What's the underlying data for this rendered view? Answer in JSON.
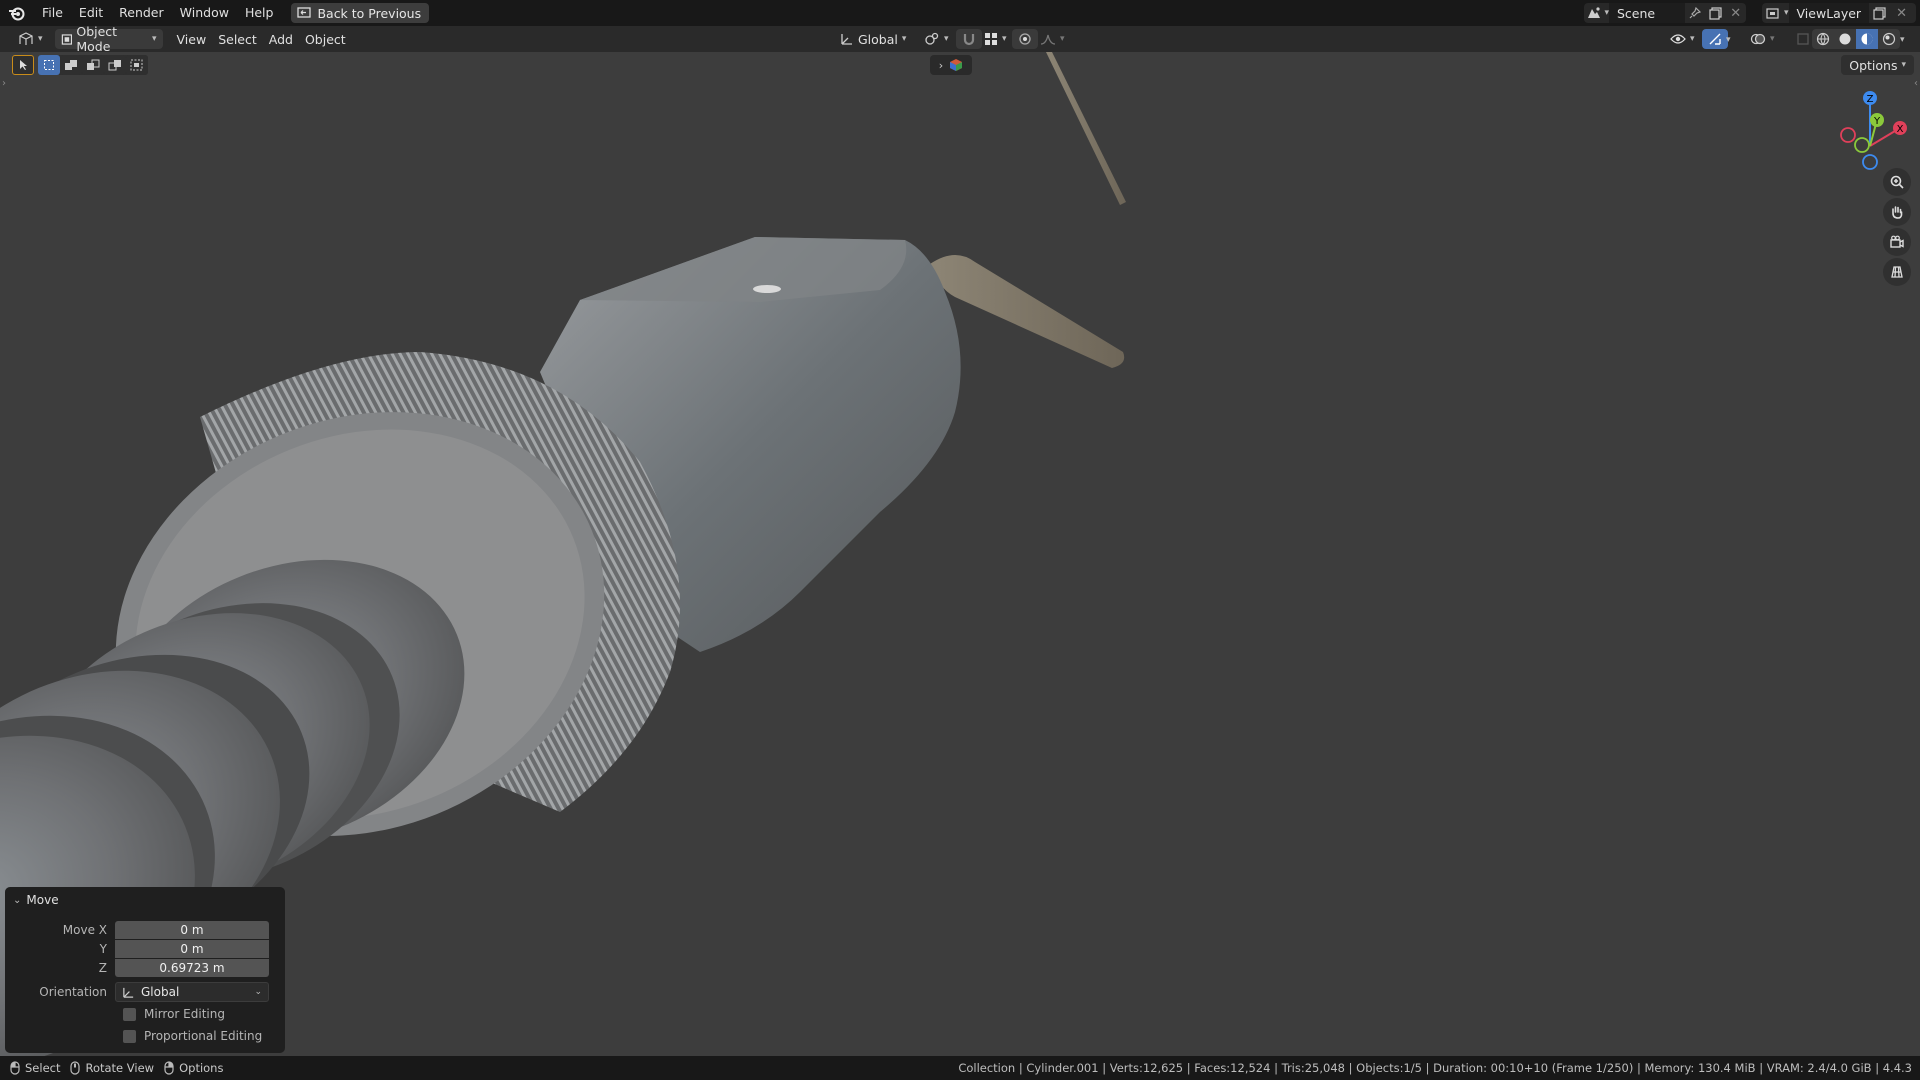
{
  "topbar": {
    "menu": [
      "File",
      "Edit",
      "Render",
      "Window",
      "Help"
    ],
    "back_button": "Back to Previous",
    "scene": "Scene",
    "view_layer": "ViewLayer"
  },
  "header": {
    "mode": "Object Mode",
    "menus": [
      "View",
      "Select",
      "Add",
      "Object"
    ],
    "transform_orientation": "Global"
  },
  "viewport": {
    "options_label": "Options",
    "gizmo_axes": [
      "Z",
      "Y",
      "X"
    ]
  },
  "operator_panel": {
    "title": "Move",
    "move_x_label": "Move X",
    "move_x": "0 m",
    "y_label": "Y",
    "y": "0 m",
    "z_label": "Z",
    "z": "0.69723 m",
    "orientation_label": "Orientation",
    "orientation": "Global",
    "mirror_editing": "Mirror Editing",
    "proportional_editing": "Proportional Editing"
  },
  "statusbar": {
    "select": "Select",
    "rotate_view": "Rotate View",
    "options": "Options",
    "info": "Collection | Cylinder.001 | Verts:12,625 | Faces:12,524 | Tris:25,048 | Objects:1/5 | Duration: 00:10+10 (Frame 1/250) | Memory: 130.4 MiB | VRAM: 2.4/4.0 GiB | 4.4.3"
  },
  "colors": {
    "accent_blue": "#4772b3",
    "axis_x": "#e0405a",
    "axis_y": "#8bc93b",
    "axis_z": "#3d8bf0",
    "viewport_bg": "#3d3d3d"
  }
}
